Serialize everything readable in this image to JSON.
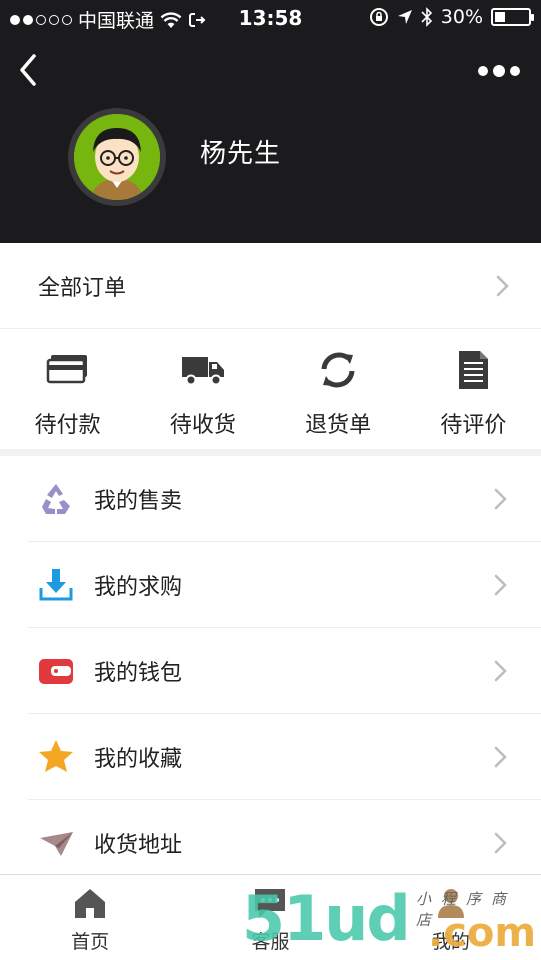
{
  "status_bar": {
    "carrier": "中国联通",
    "time": "13:58",
    "battery": "30%",
    "battery_level": 0.3
  },
  "header": {
    "username": "杨先生",
    "back_icon": "chevron-left-icon",
    "more_icon": "more-dots-icon"
  },
  "all_orders": {
    "label": "全部订单"
  },
  "order_status": [
    {
      "label": "待付款",
      "icon": "card-icon"
    },
    {
      "label": "待收货",
      "icon": "truck-icon"
    },
    {
      "label": "退货单",
      "icon": "refresh-icon"
    },
    {
      "label": "待评价",
      "icon": "document-icon"
    }
  ],
  "menu": [
    {
      "label": "我的售卖",
      "icon": "recycle-icon"
    },
    {
      "label": "我的求购",
      "icon": "download-icon"
    },
    {
      "label": "我的钱包",
      "icon": "wallet-icon"
    },
    {
      "label": "我的收藏",
      "icon": "star-icon"
    },
    {
      "label": "收货地址",
      "icon": "paper-plane-icon"
    }
  ],
  "tabs": [
    {
      "label": "首页",
      "icon": "home-icon"
    },
    {
      "label": "客服",
      "icon": "chat-icon"
    },
    {
      "label": "我的",
      "icon": "user-icon"
    }
  ],
  "watermark": {
    "main": "51ud",
    "suffix": ".com",
    "small": "小程序商店"
  },
  "colors": {
    "header_bg": "#1b1b1d",
    "avatar_green": "#77b50f",
    "wallet_red": "#e03a3e",
    "star_orange": "#f5a623",
    "download_blue": "#1e9be0"
  }
}
